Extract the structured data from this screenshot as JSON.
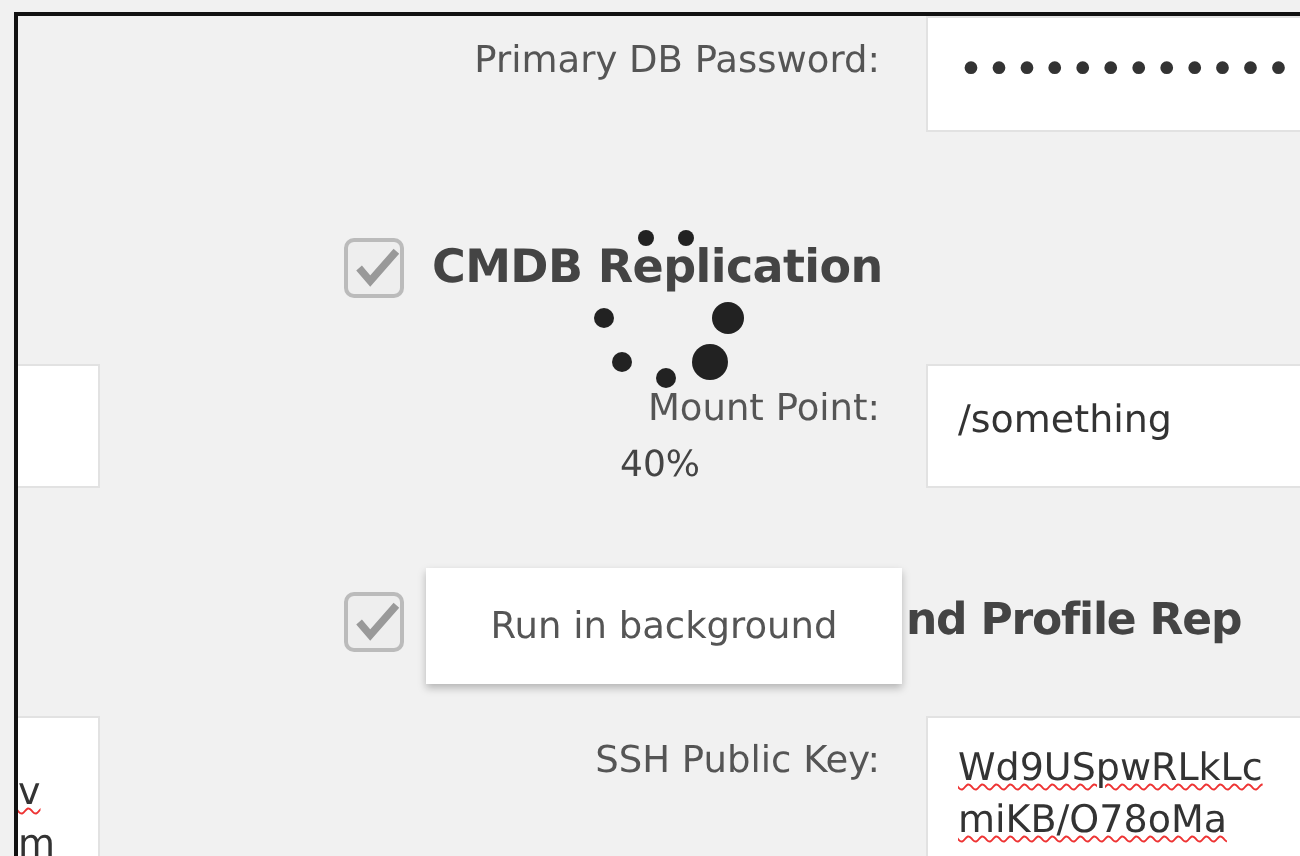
{
  "password": {
    "label": "Primary DB Password:",
    "value": "••••••••••••"
  },
  "sections": [
    {
      "title": "CMDB Replication",
      "checked": true,
      "field": {
        "label": "Mount Point:",
        "lines": [
          "/something"
        ]
      }
    },
    {
      "title": "nd Profile Rep",
      "checked": true,
      "field": {
        "label": "SSH Public Key:",
        "lines": [
          "Wd9USpwRLkLc",
          "miKB/O78oMa"
        ]
      },
      "side_lines": [
        "v",
        "m"
      ]
    }
  ],
  "progress": {
    "text": "40%"
  },
  "tooltip": {
    "text": "Run in background"
  }
}
